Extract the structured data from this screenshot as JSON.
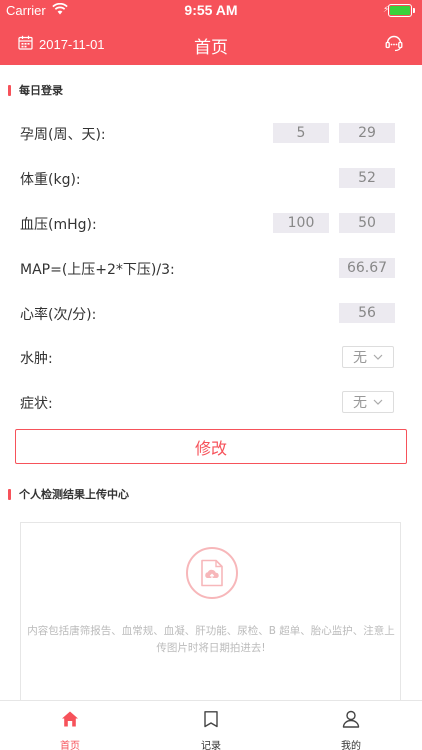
{
  "status_bar": {
    "carrier": "Carrier",
    "time": "9:55 AM"
  },
  "header": {
    "date": "2017-11-01",
    "title": "首页"
  },
  "daily_login": {
    "title": "每日登录",
    "pregnancy_week": {
      "label": "孕周(周、天):",
      "weeks": "5",
      "days": "29"
    },
    "weight": {
      "label": "体重(kg):",
      "value": "52"
    },
    "blood_pressure": {
      "label": "血压(mHg):",
      "systolic": "100",
      "diastolic": "50"
    },
    "map": {
      "label": "MAP=(上压+2*下压)/3:",
      "value": "66.67"
    },
    "heart_rate": {
      "label": "心率(次/分):",
      "value": "56"
    },
    "edema": {
      "label": "水肿:",
      "value": "无"
    },
    "symptom": {
      "label": "症状:",
      "value": "无"
    },
    "modify_button": "修改"
  },
  "upload_center": {
    "title": "个人检测结果上传中心",
    "description": "内容包括唐筛报告、血常规、血凝、肝功能、尿检、B 超单、胎心监护、注意上传图片时将日期拍进去!"
  },
  "tabbar": {
    "items": [
      {
        "label": "首页",
        "icon": "home-icon",
        "active": true
      },
      {
        "label": "记录",
        "icon": "book-icon",
        "active": false
      },
      {
        "label": "我的",
        "icon": "user-icon",
        "active": false
      }
    ]
  },
  "colors": {
    "brand": "#f6525a",
    "battery": "#3bd13b",
    "value_box": "#eceaf0"
  }
}
